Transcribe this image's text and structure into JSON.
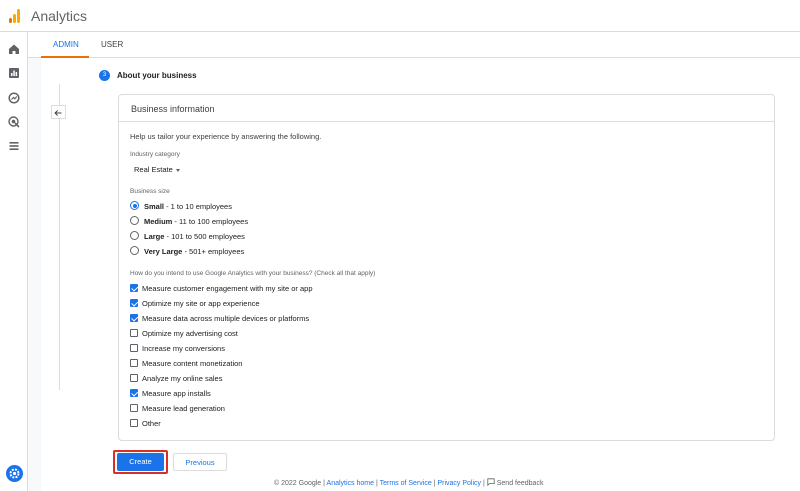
{
  "app": {
    "title": "Analytics"
  },
  "tabs": [
    {
      "label": "ADMIN",
      "active": true
    },
    {
      "label": "USER",
      "active": false
    }
  ],
  "step": {
    "number": "3",
    "title": "About your business"
  },
  "card": {
    "title": "Business information",
    "intro": "Help us tailor your experience by answering the following.",
    "industry": {
      "label": "Industry category",
      "value": "Real Estate"
    },
    "size": {
      "label": "Business size",
      "options": [
        {
          "bold": "Small",
          "rest": " - 1 to 10 employees",
          "selected": true
        },
        {
          "bold": "Medium",
          "rest": " - 11 to 100 employees",
          "selected": false
        },
        {
          "bold": "Large",
          "rest": " - 101 to 500 employees",
          "selected": false
        },
        {
          "bold": "Very Large",
          "rest": " - 501+ employees",
          "selected": false
        }
      ]
    },
    "intent": {
      "label": "How do you intend to use Google Analytics with your business? (Check all that apply)",
      "options": [
        {
          "label": "Measure customer engagement with my site or app",
          "checked": true
        },
        {
          "label": "Optimize my site or app experience",
          "checked": true
        },
        {
          "label": "Measure data across multiple devices or platforms",
          "checked": true
        },
        {
          "label": "Optimize my advertising cost",
          "checked": false
        },
        {
          "label": "Increase my conversions",
          "checked": false
        },
        {
          "label": "Measure content monetization",
          "checked": false
        },
        {
          "label": "Analyze my online sales",
          "checked": false
        },
        {
          "label": "Measure app installs",
          "checked": true
        },
        {
          "label": "Measure lead generation",
          "checked": false
        },
        {
          "label": "Other",
          "checked": false
        }
      ]
    }
  },
  "actions": {
    "create": "Create",
    "previous": "Previous"
  },
  "footer": {
    "copyright": "© 2022 Google |",
    "home": "Analytics home",
    "sep1": "|",
    "terms": "Terms of Service",
    "sep2": "|",
    "privacy": "Privacy Policy",
    "sep3": "|",
    "feedback": "Send feedback"
  },
  "icons": {
    "sidebar": [
      "home-icon",
      "reports-icon",
      "explore-icon",
      "advertising-icon",
      "configure-icon"
    ],
    "settings": "gear-icon"
  },
  "colors": {
    "accent": "#1a73e8",
    "tab_underline": "#e8710a",
    "highlight_outline": "#d93025"
  }
}
